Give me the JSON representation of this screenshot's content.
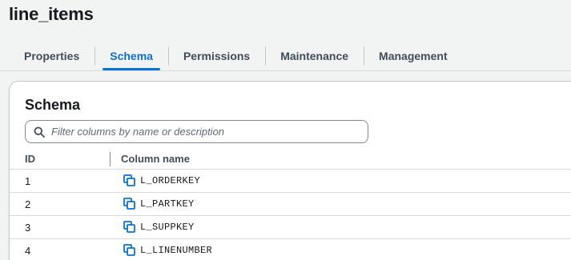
{
  "page": {
    "title": "line_items"
  },
  "tabs": [
    {
      "label": "Properties",
      "active": false
    },
    {
      "label": "Schema",
      "active": true
    },
    {
      "label": "Permissions",
      "active": false
    },
    {
      "label": "Maintenance",
      "active": false
    },
    {
      "label": "Management",
      "active": false
    }
  ],
  "schema": {
    "title": "Schema",
    "search": {
      "placeholder": "Filter columns by name or description",
      "value": ""
    },
    "columns": {
      "id": "ID",
      "name": "Column name"
    },
    "rows": [
      {
        "id": "1",
        "name": "L_ORDERKEY"
      },
      {
        "id": "2",
        "name": "L_PARTKEY"
      },
      {
        "id": "3",
        "name": "L_SUPPKEY"
      },
      {
        "id": "4",
        "name": "L_LINENUMBER"
      }
    ]
  },
  "icons": {
    "search": "search-icon",
    "copy": "copy-icon"
  },
  "colors": {
    "accent": "#0972d3",
    "active_tab_text": "#0f6fcf",
    "background": "#f2f3f3",
    "panel": "#ffffff"
  }
}
